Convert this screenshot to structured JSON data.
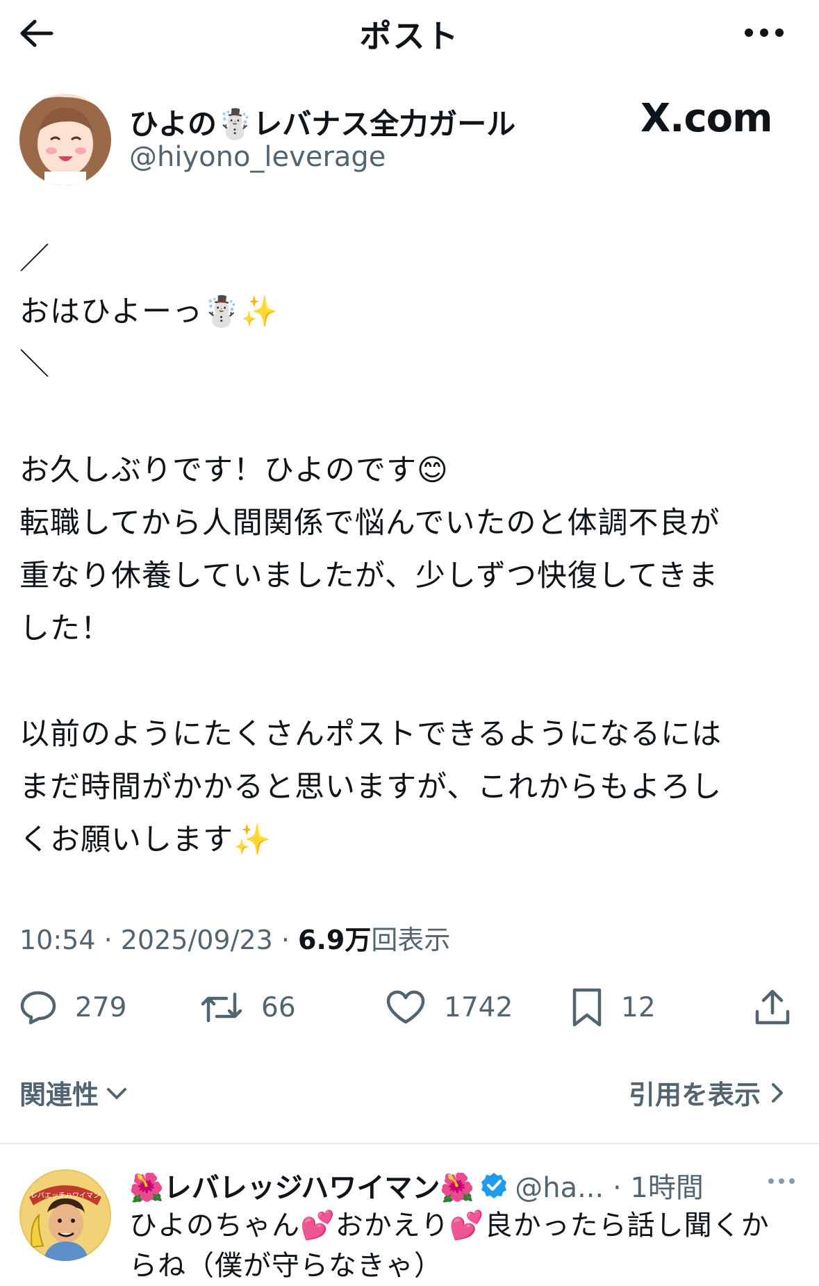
{
  "header": {
    "title": "ポスト",
    "back_icon": "arrow-left-icon",
    "more_icon": "more-horizontal-icon"
  },
  "author": {
    "name": "ひよの☃️レバナス全力ガール",
    "handle": "@hiyono_leverage"
  },
  "brand": {
    "label": "X.com"
  },
  "tweet": {
    "text": "／\nおはひよーっ☃️✨\n＼\n\nお久しぶりです！ひよのです😊\n転職してから人間関係で悩んでいたのと体調不良が\n重なり休養していましたが、少しずつ快復してきま\nした！\n\n以前のようにたくさんポストできるようになるには\nまだ時間がかかると思いますが、これからもよろし\nくお願いします✨"
  },
  "meta": {
    "time": "10:54 · 2025/09/23 · ",
    "views_count": "6.9万",
    "views_label": "回表示"
  },
  "actions": {
    "replies": "279",
    "reposts": "66",
    "likes": "1742",
    "bookmarks": "12"
  },
  "sort": {
    "label": "関連性"
  },
  "quotes": {
    "label": "引用を表示"
  },
  "reply": {
    "name": "🌺レバレッジハワイマン🌺",
    "handle": "@ha... · 1時間",
    "verified_color": "#1d9bf0",
    "text": "ひよのちゃん💕おかえり💕良かったら話し聞くか\nらね（僕が守らなきゃ）",
    "avatar_banner": "レバエッチハワイマン"
  },
  "colors": {
    "text": "#0f1419",
    "secondary": "#536471",
    "accent": "#1d9bf0"
  }
}
